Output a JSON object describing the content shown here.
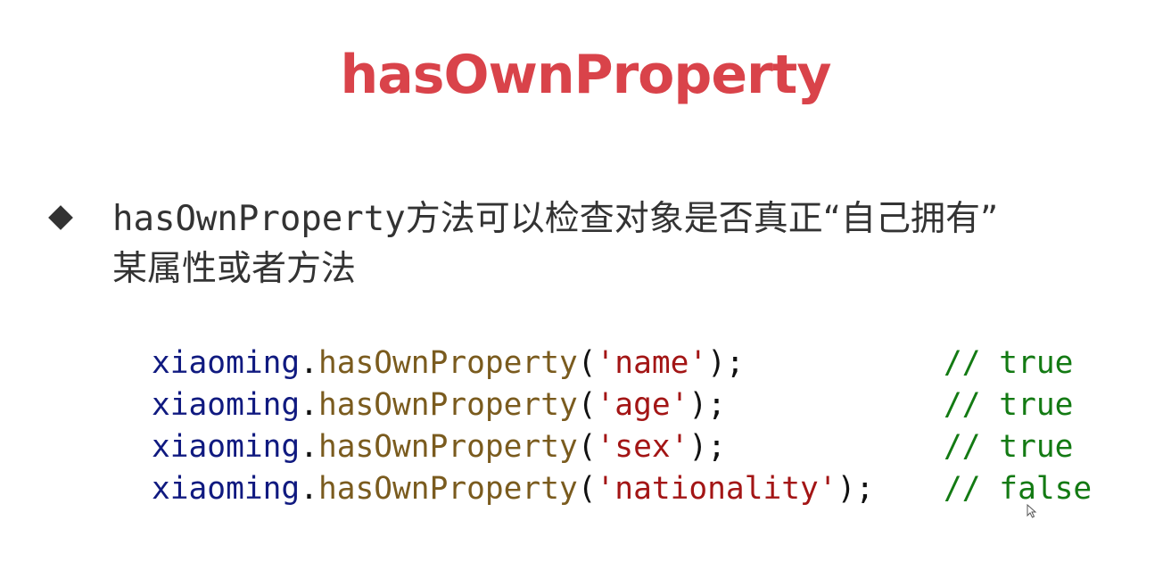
{
  "slide": {
    "title": "hasOwnProperty",
    "bullet": {
      "term": "hasOwnProperty",
      "text_line1": "方法可以检查对象是否真正“自己拥有”",
      "text_line2": "某属性或者方法"
    },
    "code_lines": [
      {
        "object": "xiaoming",
        "dot": ".",
        "method": "hasOwnProperty",
        "open": "(",
        "arg": "'name'",
        "close": ");",
        "comment": "// true"
      },
      {
        "object": "xiaoming",
        "dot": ".",
        "method": "hasOwnProperty",
        "open": "(",
        "arg": "'age'",
        "close": ");",
        "comment": "// true"
      },
      {
        "object": "xiaoming",
        "dot": ".",
        "method": "hasOwnProperty",
        "open": "(",
        "arg": "'sex'",
        "close": ");",
        "comment": "// true"
      },
      {
        "object": "xiaoming",
        "dot": ".",
        "method": "hasOwnProperty",
        "open": "(",
        "arg": "'nationality'",
        "close": ");",
        "comment": "// false"
      }
    ],
    "colors": {
      "title": "#d9434a",
      "text": "#333333",
      "code_object": "#101a80",
      "code_method": "#7a5b1e",
      "code_string": "#a31515",
      "code_comment": "#137a13"
    },
    "icons": [
      "diamond-bullet-icon",
      "mouse-cursor-icon"
    ]
  }
}
